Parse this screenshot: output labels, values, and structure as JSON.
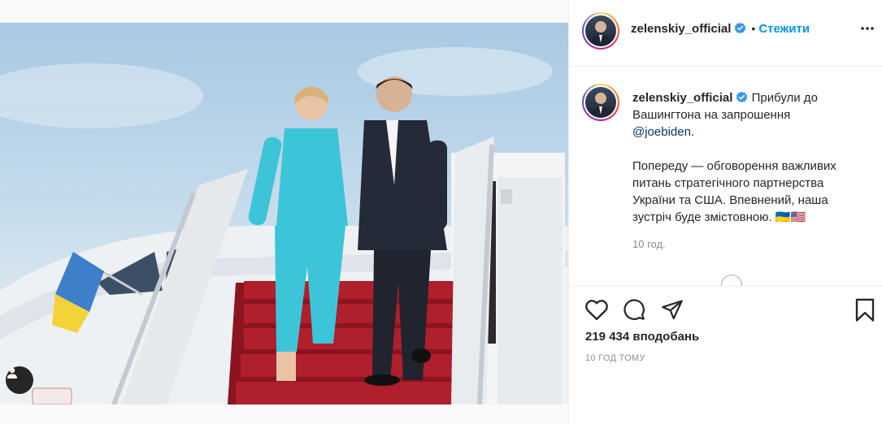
{
  "post": {
    "author": "zelenskiy_official",
    "follow_label": "Стежити",
    "separator": "•",
    "caption": {
      "line1": "Прибули до Вашингтона на запрошення",
      "mention": "@joebiden",
      "after_mention": ".",
      "paragraph2": "Попереду — обговорення важливих питань стратегічного партнерства України та США. Впевнений, наша зустріч буде змістовною.",
      "flags": "🇺🇦🇺🇸"
    },
    "caption_time": "10 год.",
    "likes": "219 434 вподобань",
    "post_time": "10 год тому"
  },
  "icons": {
    "verified": "verified-badge-icon",
    "more": "more-options-icon",
    "like": "heart-icon",
    "comment": "comment-bubble-icon",
    "share": "paper-plane-icon",
    "save": "bookmark-icon",
    "user_tags": "user-tag-icon"
  },
  "colors": {
    "link_blue": "#0095f6",
    "mention_blue": "#00376b",
    "verified_blue": "#3897f0",
    "muted": "#8e8e8e"
  }
}
